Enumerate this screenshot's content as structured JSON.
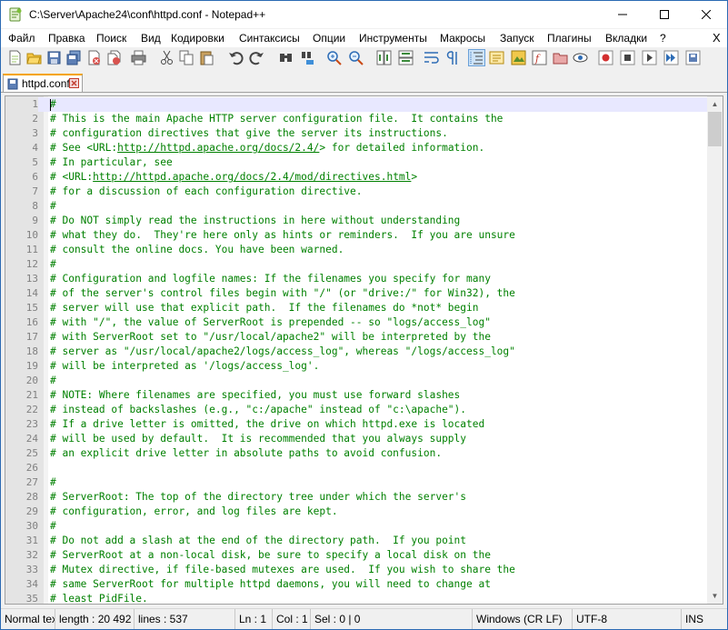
{
  "window": {
    "title": "C:\\Server\\Apache24\\conf\\httpd.conf - Notepad++"
  },
  "menu": [
    "Файл",
    "Правка",
    "Поиск",
    "Вид",
    "Кодировки",
    "Синтаксисы",
    "Опции",
    "Инструменты",
    "Макросы",
    "Запуск",
    "Плагины",
    "Вкладки",
    "?"
  ],
  "menu_close": "X",
  "toolbar_icons": [
    "new-file-icon",
    "open-file-icon",
    "save-icon",
    "save-all-icon",
    "close-icon",
    "close-all-icon",
    "print-icon",
    "cut-icon",
    "copy-icon",
    "paste-icon",
    "undo-icon",
    "redo-icon",
    "find-icon",
    "replace-icon",
    "zoom-in-icon",
    "zoom-out-icon",
    "sync-vertical-icon",
    "sync-horizontal-icon",
    "word-wrap-icon",
    "show-all-chars-icon",
    "indent-guide-icon",
    "user-defined-lang-icon",
    "doc-map-icon",
    "function-list-icon",
    "folder-as-workspace-icon",
    "monitoring-icon",
    "record-macro-icon",
    "stop-record-icon",
    "play-macro-icon",
    "play-multiple-icon",
    "save-macro-icon"
  ],
  "tab": {
    "label": "httpd.conf"
  },
  "editor": {
    "lines": [
      {
        "n": "1",
        "t": "#",
        "current": true
      },
      {
        "n": "2",
        "t": "# This is the main Apache HTTP server configuration file.  It contains the"
      },
      {
        "n": "3",
        "t": "# configuration directives that give the server its instructions."
      },
      {
        "n": "4",
        "t": "# See <URL:http://httpd.apache.org/docs/2.4/> for detailed information.",
        "pre": "# See <URL:",
        "url": "http://httpd.apache.org/docs/2.4/",
        "post": "> for detailed information."
      },
      {
        "n": "5",
        "t": "# In particular, see"
      },
      {
        "n": "6",
        "t": "# <URL:http://httpd.apache.org/docs/2.4/mod/directives.html>",
        "pre": "# <URL:",
        "url": "http://httpd.apache.org/docs/2.4/mod/directives.html",
        "post": ">"
      },
      {
        "n": "7",
        "t": "# for a discussion of each configuration directive."
      },
      {
        "n": "8",
        "t": "#"
      },
      {
        "n": "9",
        "t": "# Do NOT simply read the instructions in here without understanding"
      },
      {
        "n": "10",
        "t": "# what they do.  They're here only as hints or reminders.  If you are unsure"
      },
      {
        "n": "11",
        "t": "# consult the online docs. You have been warned."
      },
      {
        "n": "12",
        "t": "#"
      },
      {
        "n": "13",
        "t": "# Configuration and logfile names: If the filenames you specify for many"
      },
      {
        "n": "14",
        "t": "# of the server's control files begin with \"/\" (or \"drive:/\" for Win32), the"
      },
      {
        "n": "15",
        "t": "# server will use that explicit path.  If the filenames do *not* begin"
      },
      {
        "n": "16",
        "t": "# with \"/\", the value of ServerRoot is prepended -- so \"logs/access_log\""
      },
      {
        "n": "17",
        "t": "# with ServerRoot set to \"/usr/local/apache2\" will be interpreted by the"
      },
      {
        "n": "18",
        "t": "# server as \"/usr/local/apache2/logs/access_log\", whereas \"/logs/access_log\""
      },
      {
        "n": "19",
        "t": "# will be interpreted as '/logs/access_log'."
      },
      {
        "n": "20",
        "t": "#"
      },
      {
        "n": "21",
        "t": "# NOTE: Where filenames are specified, you must use forward slashes"
      },
      {
        "n": "22",
        "t": "# instead of backslashes (e.g., \"c:/apache\" instead of \"c:\\apache\")."
      },
      {
        "n": "23",
        "t": "# If a drive letter is omitted, the drive on which httpd.exe is located"
      },
      {
        "n": "24",
        "t": "# will be used by default.  It is recommended that you always supply"
      },
      {
        "n": "25",
        "t": "# an explicit drive letter in absolute paths to avoid confusion."
      },
      {
        "n": "26",
        "t": ""
      },
      {
        "n": "27",
        "t": "#"
      },
      {
        "n": "28",
        "t": "# ServerRoot: The top of the directory tree under which the server's"
      },
      {
        "n": "29",
        "t": "# configuration, error, and log files are kept."
      },
      {
        "n": "30",
        "t": "#"
      },
      {
        "n": "31",
        "t": "# Do not add a slash at the end of the directory path.  If you point"
      },
      {
        "n": "32",
        "t": "# ServerRoot at a non-local disk, be sure to specify a local disk on the"
      },
      {
        "n": "33",
        "t": "# Mutex directive, if file-based mutexes are used.  If you wish to share the"
      },
      {
        "n": "34",
        "t": "# same ServerRoot for multiple httpd daemons, you will need to change at"
      },
      {
        "n": "35",
        "t": "# least PidFile."
      }
    ]
  },
  "status": {
    "type": "Normal text file",
    "length": "length : 20 492",
    "lines": "lines : 537",
    "ln": "Ln : 1",
    "col": "Col : 1",
    "sel": "Sel : 0 | 0",
    "eol": "Windows (CR LF)",
    "encoding": "UTF-8",
    "mode": "INS"
  }
}
